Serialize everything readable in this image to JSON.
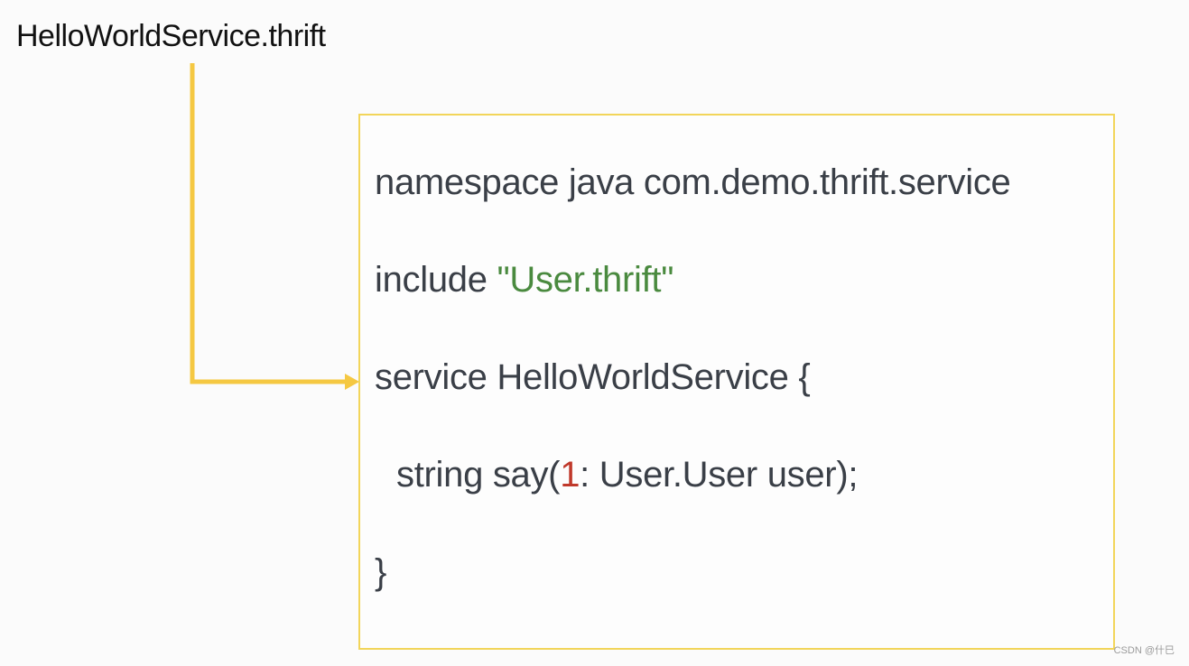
{
  "diagram": {
    "file_title": "HelloWorldService.thrift",
    "connector_color": "#f5c842",
    "box_border_color": "#f2d55a",
    "code": {
      "line_1": "namespace java com.demo.thrift.service",
      "line_2": {
        "keyword": "include ",
        "string": "\"User.thrift\""
      },
      "line_3": "service HelloWorldService {",
      "line_4": {
        "before": "string say(",
        "number": "1",
        "after": ": User.User user);"
      },
      "line_5": "}"
    },
    "colors": {
      "text": "#3a3f47",
      "string": "#4a8a3f",
      "number": "#c0392b"
    }
  },
  "watermark": "CSDN @什巳"
}
